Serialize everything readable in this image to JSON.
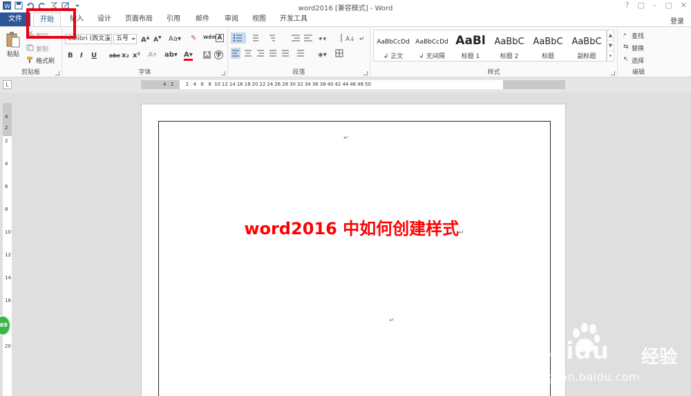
{
  "window": {
    "title": "word2016 [兼容模式] - Word",
    "controls": [
      "?",
      "▢",
      "–",
      "▢",
      "✕"
    ]
  },
  "tabs": [
    {
      "label": "文件"
    },
    {
      "label": "开始"
    },
    {
      "label": "插入"
    },
    {
      "label": "设计"
    },
    {
      "label": "页面布局"
    },
    {
      "label": "引用"
    },
    {
      "label": "邮件"
    },
    {
      "label": "审阅"
    },
    {
      "label": "视图"
    },
    {
      "label": "开发工具"
    }
  ],
  "login_label": "登录",
  "ribbon": {
    "clipboard": {
      "label": "剪贴板",
      "paste": "粘贴",
      "cut": "剪切",
      "copy": "复制",
      "format_painter": "格式刷"
    },
    "font": {
      "label": "字体",
      "font_name": "Calibri (西文正",
      "font_size": "五号",
      "buttons": [
        "B",
        "I",
        "U",
        "abc",
        "x₂",
        "x²"
      ]
    },
    "paragraph": {
      "label": "段落"
    },
    "styles": {
      "label": "样式",
      "items": [
        {
          "sample": "AaBbCcDd",
          "name": "↲ 正文"
        },
        {
          "sample": "AaBbCcDd",
          "name": "↲ 无间隔"
        },
        {
          "sample": "AaBl",
          "name": "标题 1"
        },
        {
          "sample": "AaBbC",
          "name": "标题 2"
        },
        {
          "sample": "AaBbC",
          "name": "标题"
        },
        {
          "sample": "AaBbC",
          "name": "副标题"
        }
      ]
    },
    "editing": {
      "label": "编辑",
      "find": "查找",
      "replace": "替换",
      "select": "选择"
    }
  },
  "ruler": {
    "h_numbers": [
      "4",
      "2",
      "2",
      "4",
      "6",
      "8",
      "10",
      "12",
      "14",
      "16",
      "18",
      "20",
      "22",
      "24",
      "26",
      "28",
      "30",
      "32",
      "34",
      "36",
      "38",
      "40",
      "42",
      "44",
      "46",
      "48",
      "50"
    ],
    "v_numbers": [
      "4",
      "2",
      "2",
      "4",
      "6",
      "8",
      "10",
      "12",
      "14",
      "16",
      "18",
      "20"
    ]
  },
  "document": {
    "heading": "word2016 中如何创建样式",
    "para_mark": "↵"
  },
  "side_badge": "69",
  "watermark": {
    "logo": "Baidu",
    "cn": "经验",
    "url": "jingyan.baidu.com"
  },
  "colors": {
    "file_tab": "#2b579a",
    "heading": "#ff0000",
    "highlight": "#e60012"
  }
}
